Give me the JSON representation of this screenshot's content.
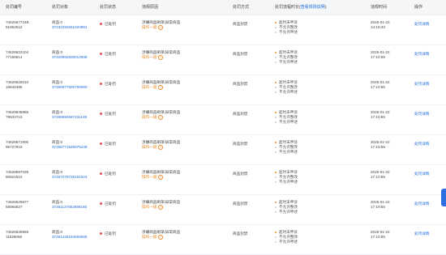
{
  "columns": {
    "id": "处罚编号",
    "object": "处罚对象",
    "status": "处罚状态",
    "reason": "违规原因",
    "method": "处罚方式",
    "steps_prefix": "处罚流程时长(",
    "steps_link": "查看规则说明",
    "steps_suffix": ")",
    "time": "违规时间",
    "op": "操作"
  },
  "rows": [
    {
      "id1": "7462567724B",
      "id2": "91652612",
      "obj_name": "商品:0",
      "obj_sub": "37232292661020981",
      "status": "已处罚",
      "reason": "涉嫌商品刷单/异常商品",
      "reason_warn": "操作一级",
      "method": "商品封禁",
      "steps": [
        "超时未申诉",
        "不允许整改",
        "不允许申述"
      ],
      "date": "2025-01-23",
      "clock": "14:15:33",
      "op": "处罚详情"
    },
    {
      "id1": "74628622104",
      "id2": "77155614",
      "obj_name": "商品:0",
      "obj_sub": "37226962625012608",
      "status": "已处罚",
      "reason": "涉嫌商品刷单/异常商品",
      "reason_warn": "操作一级",
      "method": "商品封禁",
      "steps": [
        "超时未申诉",
        "不允许整改",
        "不允许申述"
      ],
      "date": "2025-01-22",
      "clock": "17:10:55",
      "op": "处罚详情"
    },
    {
      "id1": "74628625010",
      "id2": "16640485",
      "obj_name": "商品:0",
      "obj_sub": "37266977825768080",
      "status": "已处罚",
      "reason": "涉嫌商品刷单/异常商品",
      "reason_warn": "操作一级",
      "method": "商品封禁",
      "steps": [
        "超时未申诉",
        "不允许整改",
        "不允许申述"
      ],
      "date": "2025-01-22",
      "clock": "17:10:55",
      "op": "处罚详情"
    },
    {
      "id1": "74628635886",
      "id2": "79532710",
      "obj_name": "商品:0",
      "obj_sub": "37268694597231138",
      "status": "已处罚",
      "reason": "涉嫌商品刷单/异常商品",
      "reason_warn": "操作一级",
      "method": "商品封禁",
      "steps": [
        "超时未申诉",
        "不允许整改",
        "不允许申述"
      ],
      "date": "2025-01-22",
      "clock": "17:10:55",
      "op": "处罚详情"
    },
    {
      "id1": "74628671500",
      "id2": "95727910",
      "obj_name": "商品:0",
      "obj_sub": "37266771549975449",
      "status": "已处罚",
      "reason": "涉嫌商品刷单/异常商品",
      "reason_warn": "操作一级",
      "method": "商品封禁",
      "steps": [
        "超时未申诉",
        "不允许整改",
        "不允许申述"
      ],
      "date": "2025-01-22",
      "clock": "17:10:55",
      "op": "处罚详情"
    },
    {
      "id1": "74628697039",
      "id2": "80921610",
      "obj_name": "商品:0",
      "obj_sub": "37267279725191924",
      "status": "已处罚",
      "reason": "涉嫌商品刷单/异常商品",
      "reason_warn": "操作一级",
      "method": "商品封禁",
      "steps": [
        "超时未申诉",
        "不允许整改",
        "不允许申述"
      ],
      "date": "2025-01-22",
      "clock": "17:10:55",
      "op": "处罚详情"
    },
    {
      "id1": "74628629877",
      "id2": "58966827",
      "obj_name": "商品:0",
      "obj_sub": "37261127552899185",
      "status": "已处罚",
      "reason": "涉嫌商品刷单/异常商品",
      "reason_warn": "操作一级",
      "method": "商品封禁",
      "steps": [
        "超时未申诉",
        "不允许整改",
        "不允许申述"
      ],
      "date": "2025-01-22",
      "clock": "17:10:55",
      "op": "处罚详情"
    },
    {
      "id1": "74628628559",
      "id2": "11628066",
      "obj_name": "商品:0",
      "obj_sub": "37261426164558695",
      "status": "已处罚",
      "reason": "涉嫌商品刷单/异常商品",
      "reason_warn": "操作一级",
      "method": "商品封禁",
      "steps": [
        "超时未申诉",
        "不允许整改",
        "不允许申述"
      ],
      "date": "2025-01-22",
      "clock": "17:10:55",
      "op": "处罚详情"
    }
  ],
  "colors": {
    "link": "#1f6fe0",
    "warn": "#f08a24",
    "status_dot": "#e55353"
  }
}
